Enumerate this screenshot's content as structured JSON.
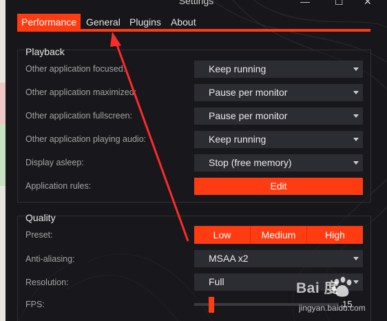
{
  "window": {
    "title": "Settings",
    "minimize_glyph": "—",
    "maximize_glyph": "☐",
    "close_glyph": "✕"
  },
  "tabs": [
    {
      "label": "Performance",
      "active": true
    },
    {
      "label": "General"
    },
    {
      "label": "Plugins"
    },
    {
      "label": "About"
    }
  ],
  "playback": {
    "title": "Playback",
    "rows": [
      {
        "label": "Other application focused:",
        "value": "Keep running"
      },
      {
        "label": "Other application maximized:",
        "value": "Pause per monitor"
      },
      {
        "label": "Other application fullscreen:",
        "value": "Pause per monitor"
      },
      {
        "label": "Other application playing audio:",
        "value": "Keep running"
      },
      {
        "label": "Display asleep:",
        "value": "Stop (free memory)"
      }
    ],
    "rules_label": "Application rules:",
    "rules_button": "Edit"
  },
  "quality": {
    "title": "Quality",
    "preset_label": "Preset:",
    "presets": [
      "Low",
      "Medium",
      "High"
    ],
    "aa_label": "Anti-aliasing:",
    "aa_value": "MSAA x2",
    "res_label": "Resolution:",
    "res_value": "Full",
    "fps_label": "FPS:",
    "fps_value": "15",
    "fps_fraction": 0.1
  },
  "watermark": {
    "logo": "Bai 度",
    "url": "jingyan.baidu.com"
  },
  "colors": {
    "accent": "#ff3b12",
    "background": "#17171b",
    "dropdown": "#2c2c33"
  },
  "icons": [
    "minimize-icon",
    "maximize-icon",
    "close-icon",
    "chevron-down-icon",
    "paw-icon"
  ]
}
